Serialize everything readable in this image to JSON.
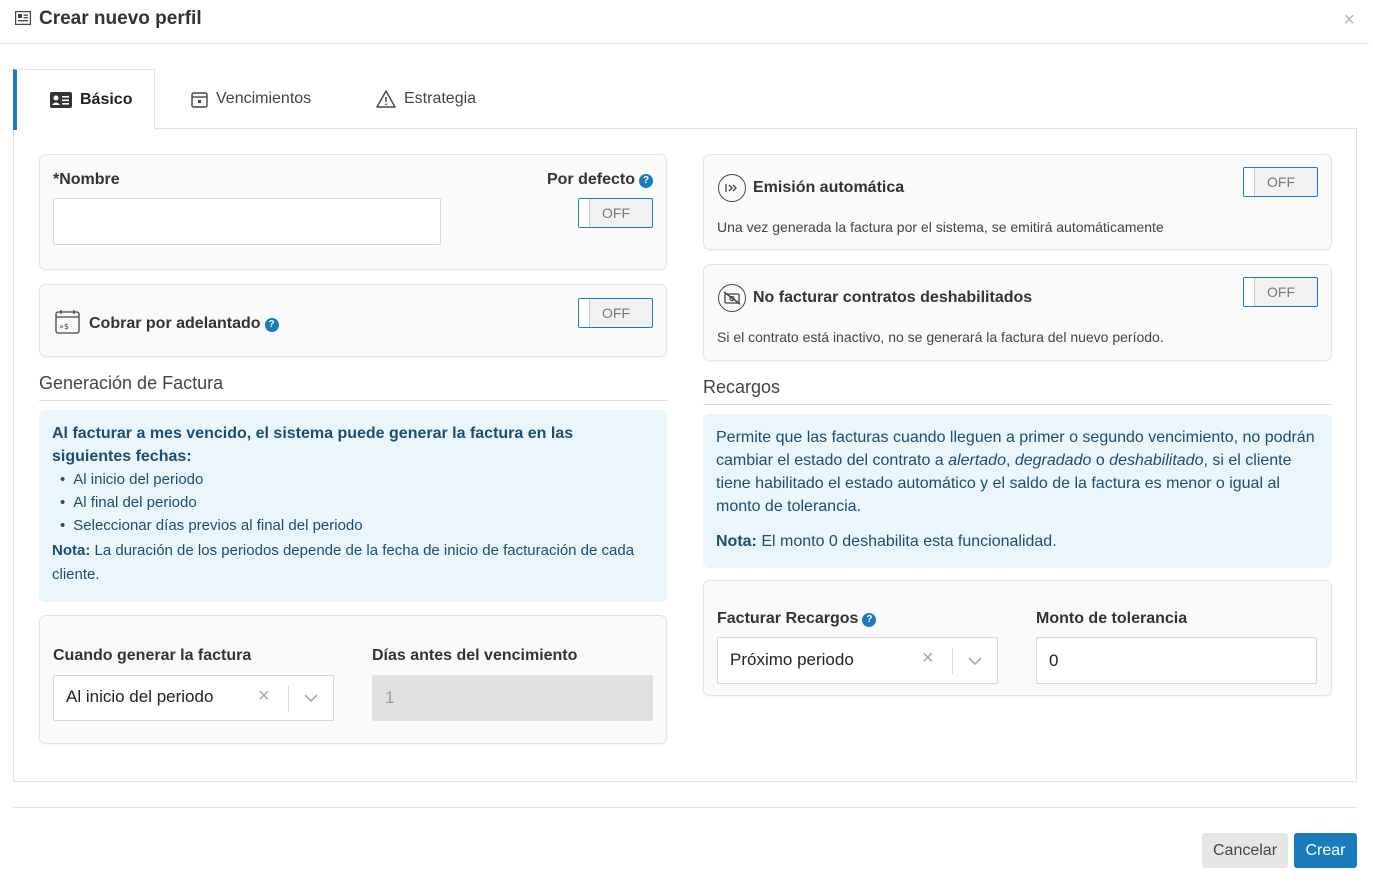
{
  "dialog": {
    "title": "Crear nuevo perfil",
    "close": "×"
  },
  "tabs": [
    {
      "label": "Básico",
      "icon": "id-card-icon",
      "active": true
    },
    {
      "label": "Vencimientos",
      "icon": "calendar-icon",
      "active": false
    },
    {
      "label": "Estrategia",
      "icon": "warning-icon",
      "active": false
    }
  ],
  "name_card": {
    "label": "*Nombre",
    "value": "",
    "default_label": "Por defecto",
    "default_toggle": "OFF"
  },
  "advance_card": {
    "label": "Cobrar por adelantado",
    "toggle": "OFF"
  },
  "auto_emit_card": {
    "label": "Emisión automática",
    "toggle": "OFF",
    "description": "Una vez generada la factura por el sistema, se emitirá automáticamente"
  },
  "disabled_contracts_card": {
    "label": "No facturar contratos deshabilitados",
    "toggle": "OFF",
    "description": "Si el contrato está inactivo, no se generará la factura del nuevo período."
  },
  "invoice_generation": {
    "section_title": "Generación de Factura",
    "info_heading": "Al facturar a mes vencido, el sistema puede generar la factura en las siguientes fechas:",
    "info_items": [
      "Al inicio del periodo",
      "Al final del periodo",
      "Seleccionar días previos al final del periodo"
    ],
    "note_label": "Nota:",
    "note_text": "La duración de los periodos depende de la fecha de inicio de facturación de cada cliente.",
    "when_label": "Cuando generar la factura",
    "when_value": "Al inicio del periodo",
    "days_label": "Días antes del vencimiento",
    "days_value": "1"
  },
  "surcharges": {
    "section_title": "Recargos",
    "info_part1": "Permite que las facturas cuando lleguen a primer o segundo vencimiento, no podrán cambiar el estado del contrato a ",
    "info_em1": "alertado",
    "info_comma": ", ",
    "info_em2": "degradado",
    "info_o": " o ",
    "info_em3": "deshabilitado",
    "info_part2": ", si el cliente tiene habilitado el estado automático y el saldo de la factura es menor o igual al monto de tolerancia.",
    "note_label": "Nota:",
    "note_text": "El monto 0 deshabilita esta funcionalidad.",
    "bill_label": "Facturar Recargos",
    "bill_value": "Próximo periodo",
    "tolerance_label": "Monto de tolerancia",
    "tolerance_value": "0"
  },
  "footer": {
    "cancel": "Cancelar",
    "create": "Crear"
  },
  "colors": {
    "accent": "#1a7bbd",
    "info_bg": "#eaf5fc",
    "info_text": "#1d4e6e"
  }
}
